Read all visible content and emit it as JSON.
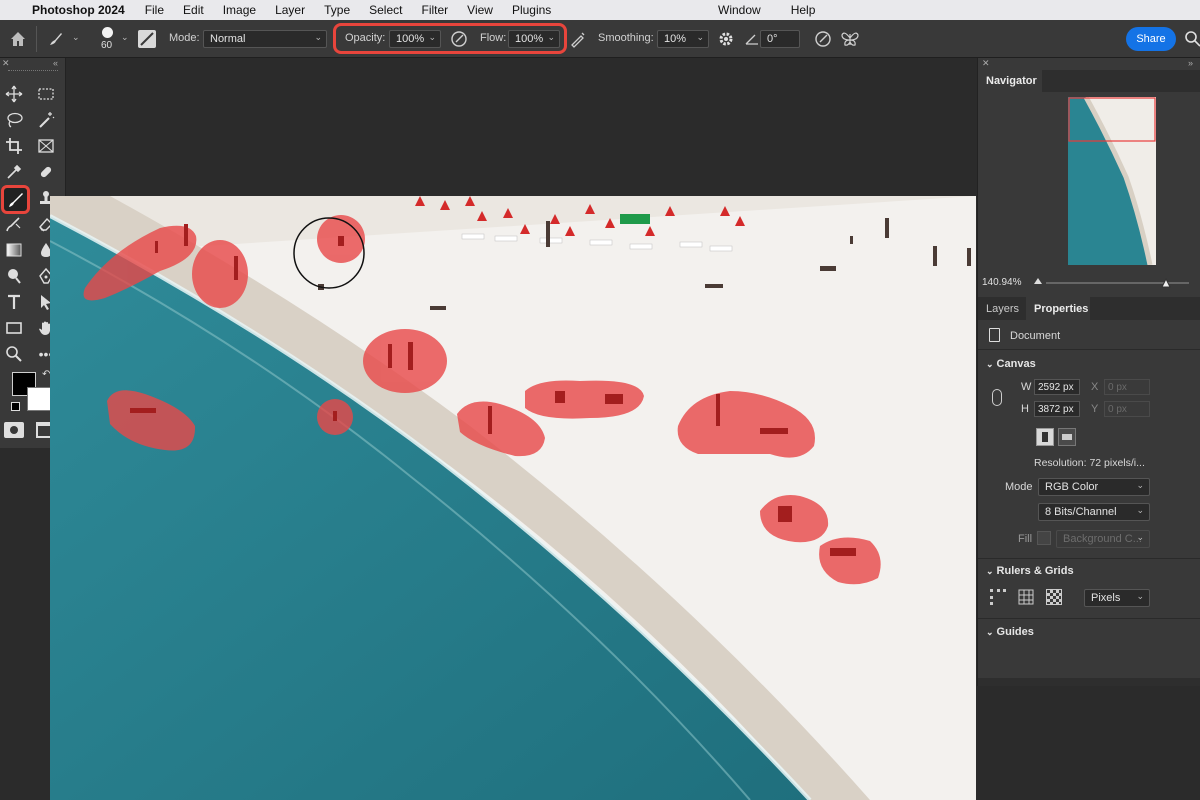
{
  "menubar": {
    "app_name": "Photoshop 2024",
    "items": [
      "File",
      "Edit",
      "Image",
      "Layer",
      "Type",
      "Select",
      "Filter",
      "View",
      "Plugins"
    ],
    "right_items": [
      "Window",
      "Help"
    ]
  },
  "options": {
    "brush_size": "60",
    "mode_label": "Mode:",
    "mode_value": "Normal",
    "opacity_label": "Opacity:",
    "opacity_value": "100%",
    "flow_label": "Flow:",
    "flow_value": "100%",
    "smoothing_label": "Smoothing:",
    "smoothing_value": "10%",
    "angle_value": "0°",
    "share_label": "Share"
  },
  "navigator": {
    "tab": "Navigator",
    "zoom": "140.94%",
    "zoom_slider_fraction": 0.84
  },
  "properties": {
    "tab_layers": "Layers",
    "tab_properties": "Properties",
    "doc_label": "Document",
    "canvas_section": "Canvas",
    "w_label": "W",
    "w_value": "2592 px",
    "h_label": "H",
    "h_value": "3872 px",
    "x_label": "X",
    "x_value": "0 px",
    "y_label": "Y",
    "y_value": "0 px",
    "resolution": "Resolution: 72 pixels/i...",
    "mode_label": "Mode",
    "mode_value": "RGB Color",
    "bits_value": "8 Bits/Channel",
    "fill_label": "Fill",
    "fill_value": "Background C...",
    "rulers_section": "Rulers & Grids",
    "units_value": "Pixels",
    "guides_section": "Guides"
  },
  "colors": {
    "accent": "#1473e6",
    "highlight": "#e8453c",
    "mask": "#e94848",
    "water": "#2b8795",
    "sand": "#ece8e2"
  }
}
